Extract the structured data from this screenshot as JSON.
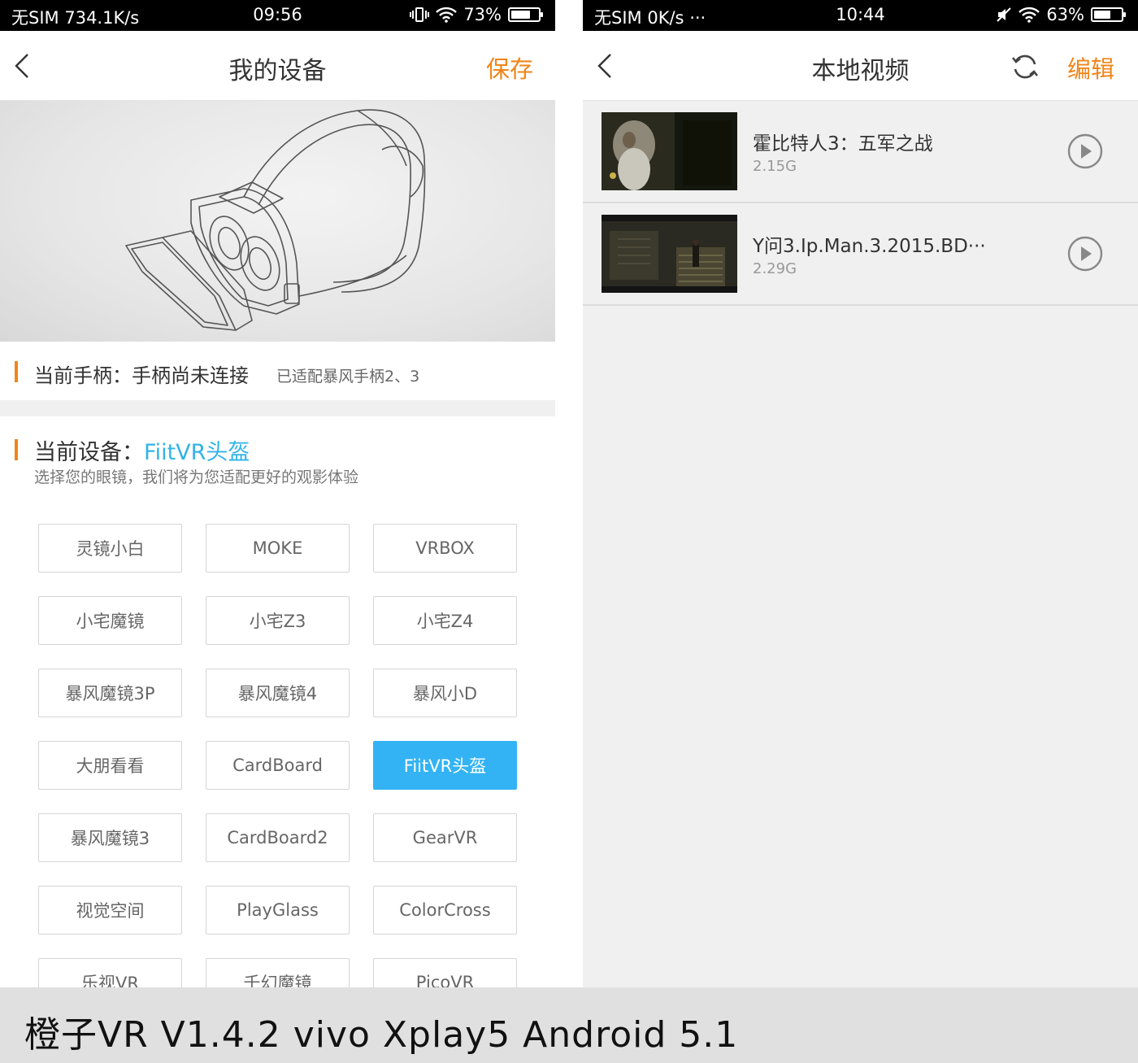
{
  "left": {
    "status": {
      "carrier": "无SIM",
      "speed": "734.1K/s",
      "time": "09:56",
      "battery": "73%",
      "battery_level": 0.73
    },
    "nav": {
      "title": "我的设备",
      "action": "保存"
    },
    "controller": {
      "label": "当前手柄：手柄尚未连接",
      "hint": "已适配暴风手柄2、3"
    },
    "device": {
      "title_prefix": "当前设备：",
      "current": "FiitVR头盔",
      "subtitle": "选择您的眼镜，我们将为您适配更好的观影体验",
      "options": [
        "灵镜小白",
        "MOKE",
        "VRBOX",
        "小宅魔镜",
        "小宅Z3",
        "小宅Z4",
        "暴风魔镜3P",
        "暴风魔镜4",
        "暴风小D",
        "大朋看看",
        "CardBoard",
        "FiitVR头盔",
        "暴风魔镜3",
        "CardBoard2",
        "GearVR",
        "视觉空间",
        "PlayGlass",
        "ColorCross",
        "乐视VR",
        "千幻魔镜",
        "PicoVR"
      ],
      "selected": "FiitVR头盔"
    }
  },
  "right": {
    "status": {
      "carrier": "无SIM",
      "speed": "0K/s",
      "more": "···",
      "time": "10:44",
      "battery": "63%",
      "battery_level": 0.63
    },
    "nav": {
      "title": "本地视频",
      "action": "编辑"
    },
    "videos": [
      {
        "title": "霍比特人3：五军之战",
        "size": "2.15G"
      },
      {
        "title": "Y问3.Ip.Man.3.2015.BD···",
        "size": "2.29G"
      }
    ]
  },
  "caption": "橙子VR V1.4.2  vivo Xplay5 Android 5.1",
  "colors": {
    "accent": "#f08519",
    "selected": "#33b3f3",
    "device_accent": "#31b3e8"
  }
}
